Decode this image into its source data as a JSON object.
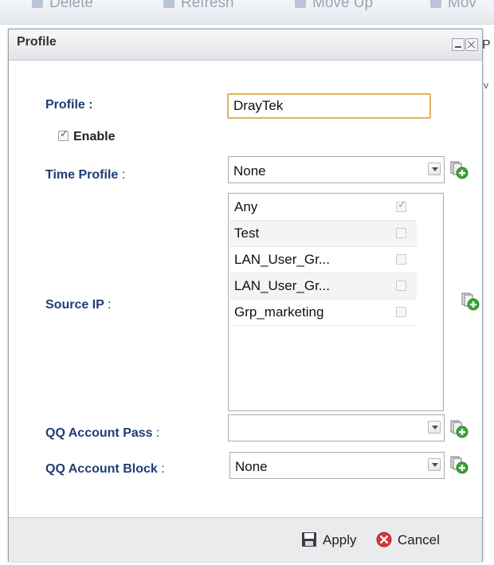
{
  "background": {
    "toolbar_items": [
      "Delete",
      "Refresh",
      "Move Up",
      "Mov"
    ],
    "side_edge_text": "P",
    "side_edge_small": "v"
  },
  "dialog": {
    "title": "Profile",
    "profile_label": "Profile :",
    "profile_value": "DrayTek",
    "enable_label": "Enable",
    "enable_checked": true,
    "time_profile_label": "Time Profile",
    "time_profile_value": "None",
    "source_ip_label": "Source IP",
    "source_ip_items": [
      {
        "label": "Any",
        "checked": true,
        "disabled": true
      },
      {
        "label": "Test",
        "checked": false,
        "disabled": true
      },
      {
        "label": "LAN_User_Gr...",
        "checked": false,
        "disabled": true
      },
      {
        "label": "LAN_User_Gr...",
        "checked": false,
        "disabled": true
      },
      {
        "label": "Grp_marketing",
        "checked": false,
        "disabled": true
      }
    ],
    "qq_pass_label": "QQ Account Pass",
    "qq_pass_value": "",
    "qq_block_label": "QQ Account Block",
    "qq_block_value": "None",
    "colon": ":",
    "apply_label": "Apply",
    "cancel_label": "Cancel"
  },
  "colors": {
    "label_blue": "#1f3d75",
    "input_focus_border": "#e0b25a",
    "add_icon_green": "#3aa335",
    "cancel_red": "#d9363e"
  }
}
